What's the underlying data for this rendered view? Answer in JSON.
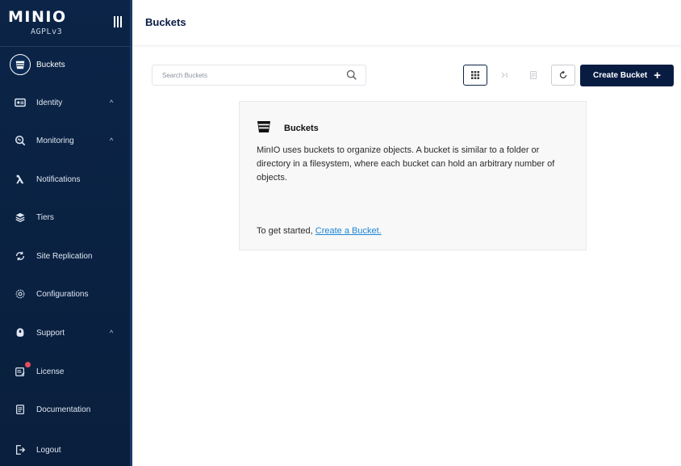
{
  "brand": {
    "logo": "MINIO",
    "license": "AGPLv3"
  },
  "sidebar": {
    "items": [
      {
        "label": "Buckets",
        "icon": "bucket-icon",
        "active": true,
        "chevron": ""
      },
      {
        "label": "Identity",
        "icon": "identity-icon",
        "chevron": "^"
      },
      {
        "label": "Monitoring",
        "icon": "monitoring-icon",
        "chevron": "^"
      },
      {
        "label": "Notifications",
        "icon": "lambda-icon",
        "chevron": ""
      },
      {
        "label": "Tiers",
        "icon": "tiers-icon",
        "chevron": ""
      },
      {
        "label": "Site Replication",
        "icon": "replication-icon",
        "chevron": ""
      },
      {
        "label": "Configurations",
        "icon": "gear-icon",
        "chevron": ""
      },
      {
        "label": "Support",
        "icon": "support-icon",
        "chevron": "^"
      },
      {
        "label": "License",
        "icon": "license-icon",
        "chevron": ""
      },
      {
        "label": "Documentation",
        "icon": "documentation-icon",
        "chevron": ""
      },
      {
        "label": "Logout",
        "icon": "logout-icon",
        "chevron": ""
      }
    ]
  },
  "header": {
    "title": "Buckets"
  },
  "toolbar": {
    "search_placeholder": "Search Buckets",
    "create_label": "Create Bucket",
    "create_icon": "+"
  },
  "empty_state": {
    "title": "Buckets",
    "body": "MinIO uses buckets to organize objects. A bucket is similar to a folder or directory in a filesystem, where each bucket can hold an arbitrary number of objects.",
    "cta_prefix": "To get started, ",
    "cta_link": "Create a Bucket."
  },
  "colors": {
    "sidebar_bg": "#0b2447",
    "primary": "#081c42",
    "link": "#1c86d6",
    "badge": "#e74c5e"
  }
}
